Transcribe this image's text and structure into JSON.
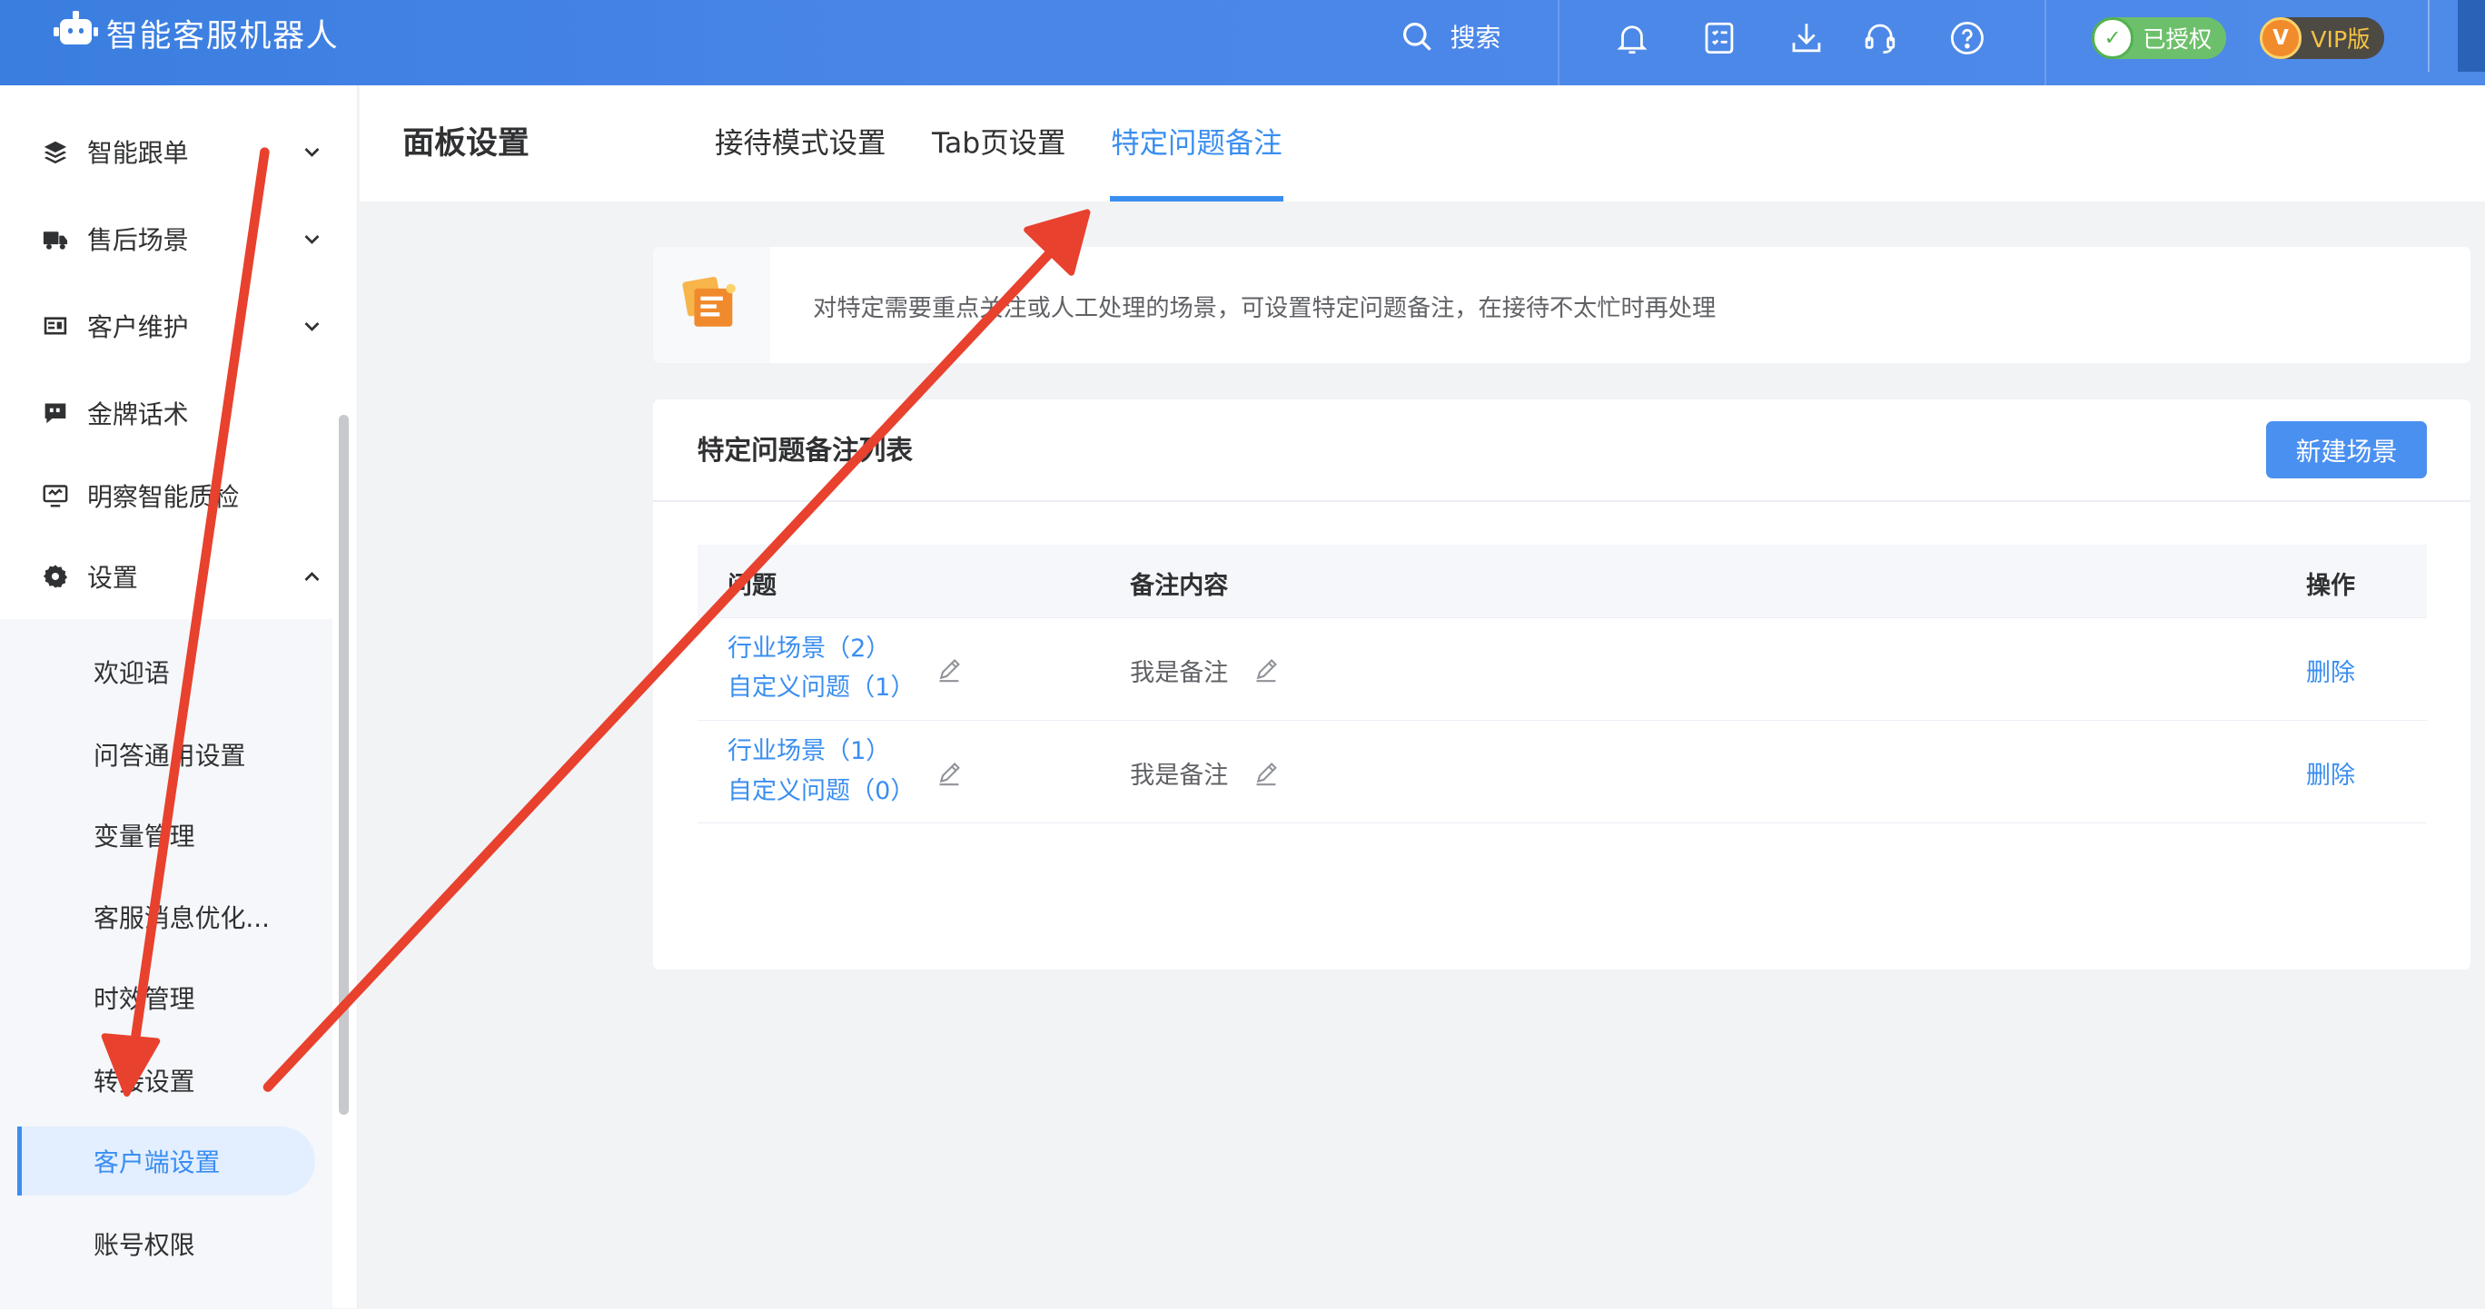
{
  "header": {
    "app_title": "智能客服机器人",
    "search_label": "搜索",
    "icons": [
      "bell-icon",
      "task-list-icon",
      "download-icon",
      "headset-icon",
      "help-icon"
    ],
    "badges": {
      "authorized": "已授权",
      "vip": "VIP版"
    }
  },
  "sidebar": {
    "items": [
      {
        "label": "智能跟单",
        "icon": "layers-icon",
        "expanded": false
      },
      {
        "label": "售后场景",
        "icon": "truck-icon",
        "expanded": false
      },
      {
        "label": "客户维护",
        "icon": "id-card-icon",
        "expanded": false
      },
      {
        "label": "金牌话术",
        "icon": "quote-icon"
      },
      {
        "label": "明察智能质检",
        "icon": "monitor-icon"
      },
      {
        "label": "设置",
        "icon": "gear-icon",
        "expanded": true
      }
    ],
    "sub_items": [
      "欢迎语",
      "问答通用设置",
      "变量管理",
      "客服消息优化...",
      "时效管理",
      "转接设置",
      "客户端设置",
      "账号权限"
    ],
    "active_sub_item": "客户端设置"
  },
  "page": {
    "title": "面板设置",
    "tabs": [
      "接待模式设置",
      "Tab页设置",
      "特定问题备注"
    ],
    "active_tab": "特定问题备注"
  },
  "intro": {
    "text": "对特定需要重点关注或人工处理的场景，可设置特定问题备注，在接待不太忙时再处理"
  },
  "list": {
    "title": "特定问题备注列表",
    "new_button": "新建场景",
    "columns": [
      "问题",
      "备注内容",
      "操作"
    ],
    "rows": [
      {
        "q1": "行业场景（2）",
        "q2": "自定义问题（1）",
        "note": "我是备注",
        "action": "删除"
      },
      {
        "q1": "行业场景（1）",
        "q2": "自定义问题（0）",
        "note": "我是备注",
        "action": "删除"
      }
    ]
  },
  "colors": {
    "header_bg": "#4a86e8",
    "accent": "#3a8ef0",
    "annotation_arrow": "#e8412e",
    "authorized_badge": "#6dc06b",
    "vip_badge": "#4d4a44"
  }
}
